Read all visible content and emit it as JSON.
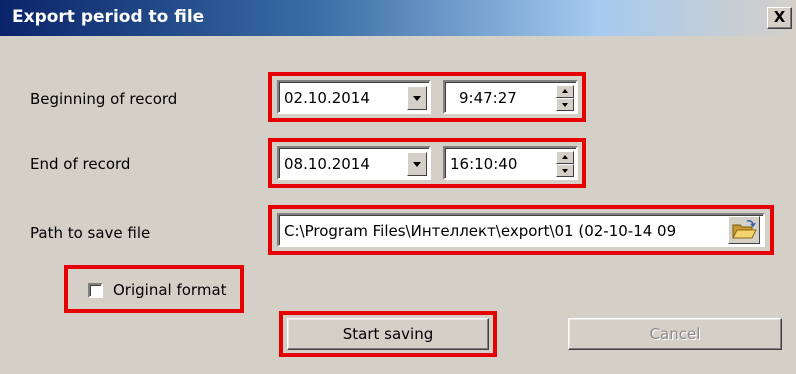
{
  "dialog": {
    "title": "Export period to file",
    "close_label": "X"
  },
  "beginning": {
    "label": "Beginning of record",
    "date": "02.10.2014",
    "time": "9:47:27"
  },
  "end": {
    "label": "End of record",
    "date": "08.10.2014",
    "time": "16:10:40"
  },
  "path": {
    "label": "Path to save file",
    "value": "C:\\Program Files\\Интеллект\\export\\01  (02-10-14 09",
    "browse_icon": "folder-open-icon"
  },
  "original_format": {
    "label": "Original format",
    "checked": false
  },
  "buttons": {
    "start_label": "Start saving",
    "cancel_label": "Cancel"
  },
  "colors": {
    "highlight": "#e60000",
    "window_face": "#d4d0c8",
    "title_bar_start": "#0a246a"
  }
}
